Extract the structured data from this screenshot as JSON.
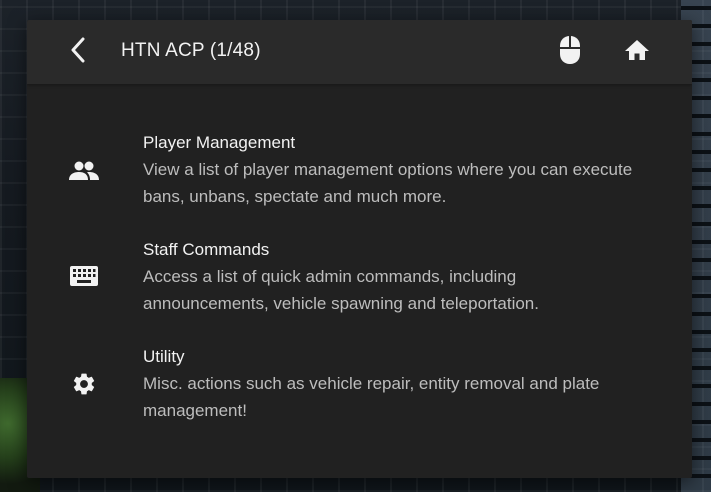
{
  "header": {
    "title": "HTN ACP (1/48)",
    "back_icon": "chevron-left-icon",
    "mouse_icon": "mouse-icon",
    "home_icon": "home-icon"
  },
  "menu": {
    "items": [
      {
        "title": "Player Management",
        "description": "View a list of player management options where you can execute bans, unbans, spectate and much more.",
        "icon": "people-icon"
      },
      {
        "title": "Staff Commands",
        "description": "Access a list of quick admin commands, including announcements, vehicle spawning and teleportation.",
        "icon": "keyboard-icon"
      },
      {
        "title": "Utility",
        "description": "Misc. actions such as vehicle repair, entity removal and plate management!",
        "icon": "gear-icon"
      }
    ]
  },
  "colors": {
    "panel": "#212121",
    "header": "#2a2a2a",
    "text_primary": "#f2f2f2",
    "text_secondary": "#bdbdbd"
  }
}
